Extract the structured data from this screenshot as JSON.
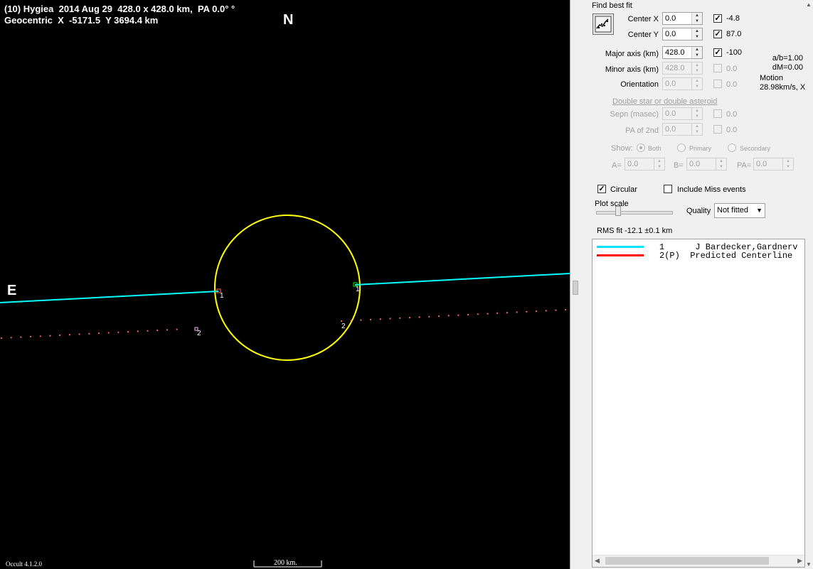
{
  "plot": {
    "title_line1": "(10) Hygiea  2014 Aug 29  428.0 x 428.0 km,  PA 0.0° °",
    "title_line2": "Geocentric  X  -5171.5  Y 3694.4 km",
    "north_label": "N",
    "east_label": "E",
    "version": "Occult 4.1.2.0",
    "scale_label": "200 km.",
    "chord_labels": [
      "1",
      "1",
      "2",
      "2"
    ],
    "colors": {
      "background": "#000000",
      "ellipse": "#ffff00",
      "chord_observed": "#00ffff",
      "predicted_dots": "#ff6a6a"
    }
  },
  "fit": {
    "find_best_fit_label": "Find best fit",
    "fit_button_icon": "fit-graph-icon",
    "center_x": {
      "label": "Center X",
      "value": "0.0",
      "checked": true,
      "result": "-4.8"
    },
    "center_y": {
      "label": "Center Y",
      "value": "0.0",
      "checked": true,
      "result": "87.0"
    },
    "major_axis": {
      "label": "Major axis (km)",
      "value": "428.0",
      "checked": true,
      "result": "-100"
    },
    "minor_axis": {
      "label": "Minor axis (km)",
      "value": "428.0",
      "checked": false,
      "result": "0.0"
    },
    "orientation": {
      "label": "Orientation",
      "value": "0.0",
      "checked": false,
      "result": "0.0"
    },
    "ab_ratio": "a/b=1.00",
    "dm": "dM=0.00",
    "motion_label": "Motion",
    "motion_value": "28.98km/s, X"
  },
  "double": {
    "heading": "Double star  or  double asteroid",
    "sepn": {
      "label": "Sepn (masec)",
      "value": "0.0",
      "result": "0.0"
    },
    "pa2nd": {
      "label": "PA of 2nd",
      "value": "0.0",
      "result": "0.0"
    },
    "show_label": "Show:",
    "show_options": [
      "Both",
      "Primary",
      "Secondary"
    ],
    "show_selected": "Both",
    "a_label": "A=",
    "a_value": "0.0",
    "b_label": "B=",
    "b_value": "0.0",
    "pa_label": "PA=",
    "pa_value": "0.0"
  },
  "options": {
    "circular_label": "Circular",
    "circular_checked": true,
    "miss_label": "Include Miss events",
    "miss_checked": false,
    "plot_scale_label": "Plot scale",
    "quality_label": "Quality",
    "quality_value": "Not fitted",
    "rms_label": "RMS fit -12.1 ±0.1 km"
  },
  "chords": [
    {
      "num": "1",
      "text": "1      J Bardecker,Gardnerv",
      "color": "#00e5ff"
    },
    {
      "num": "2",
      "text": "2(P)  Predicted Centerline",
      "color": "#ff0000"
    }
  ]
}
